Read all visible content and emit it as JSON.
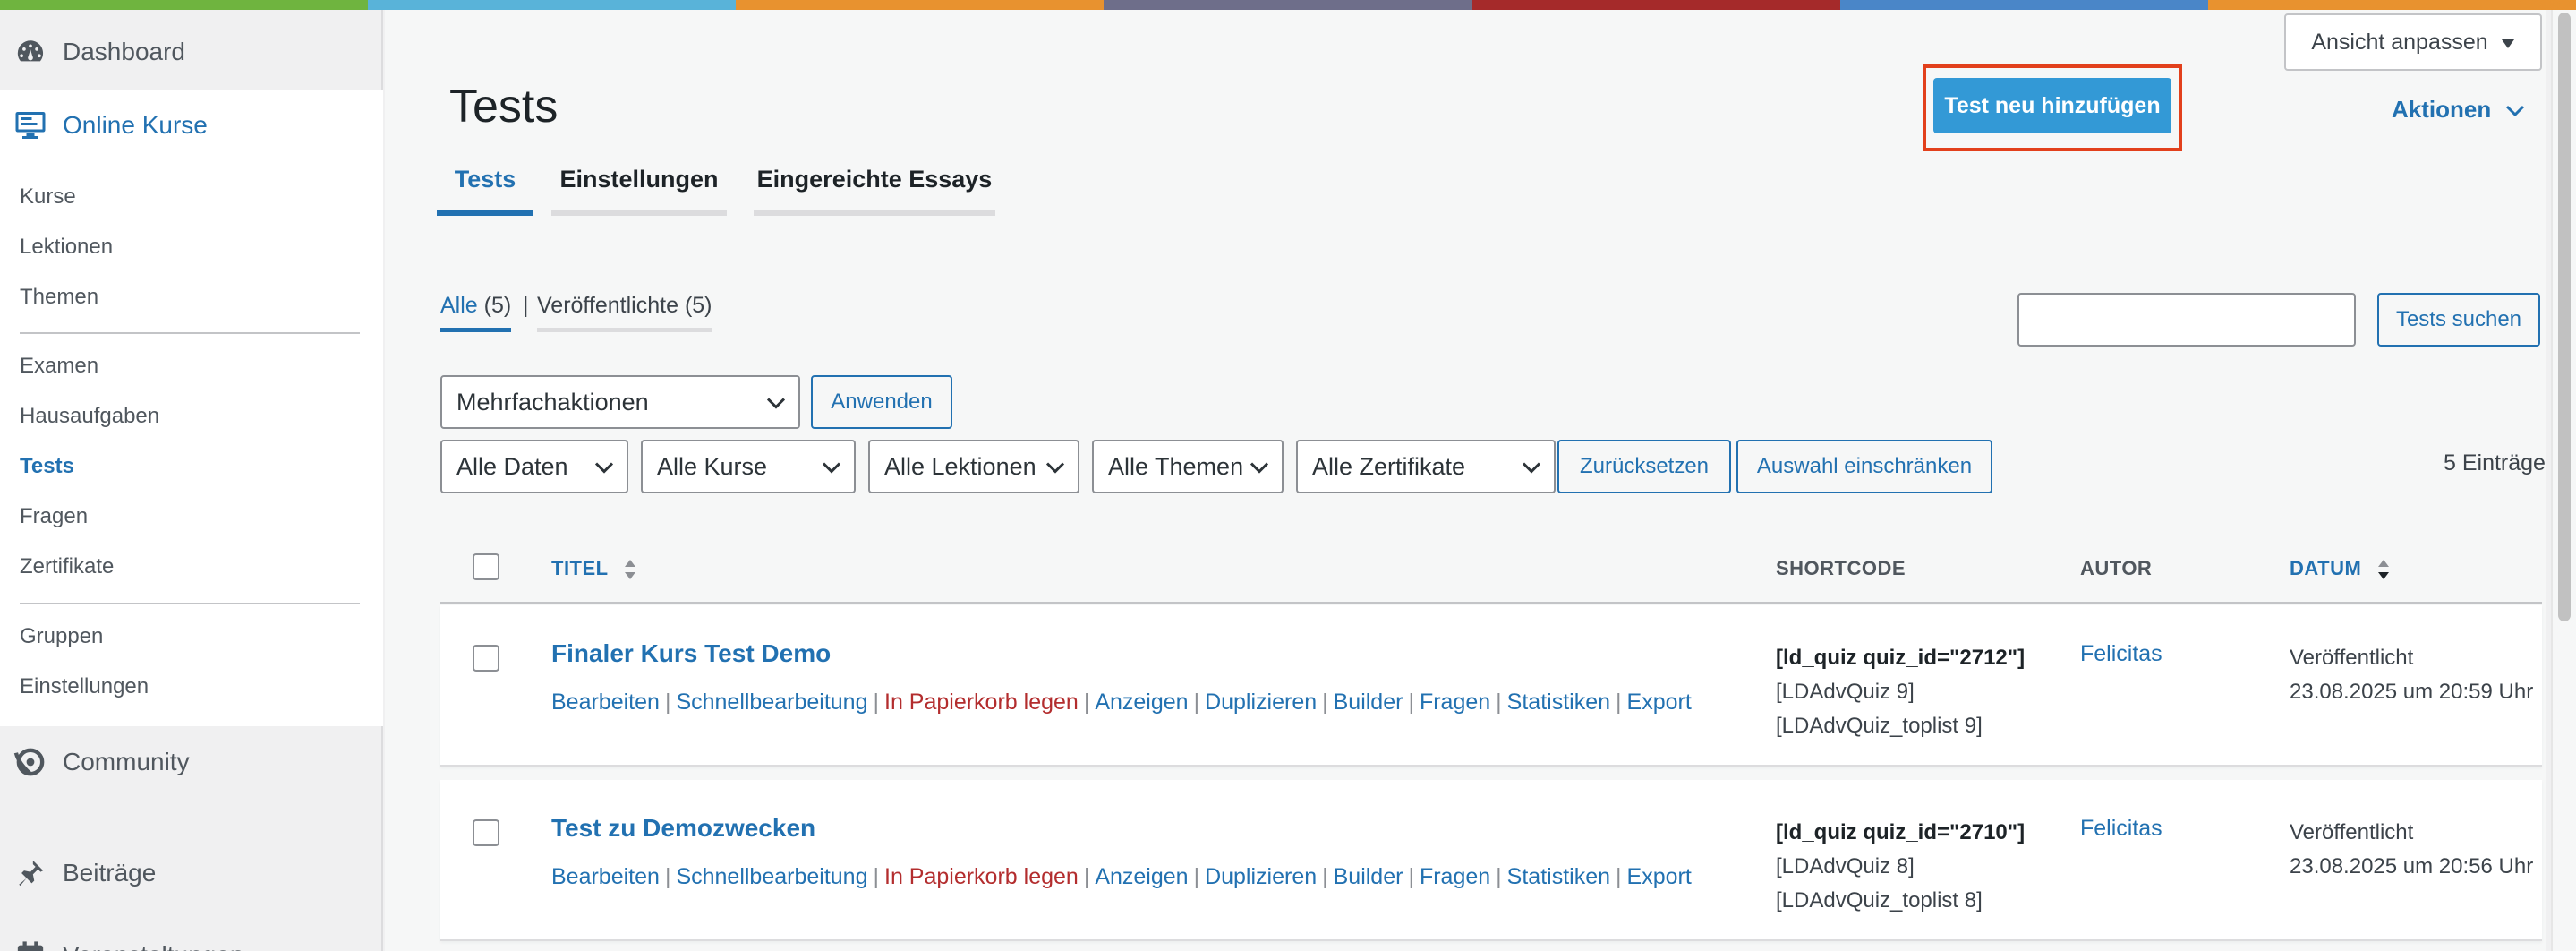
{
  "colors": {
    "rainbow": [
      "#6fb43f",
      "#59b3d9",
      "#e8922f",
      "#6e6e8a",
      "#a52a2a",
      "#4a86c8",
      "#e8922f"
    ],
    "accent": "#2271b1",
    "primary_button": "#3399d6",
    "highlight_outline": "#e2401c",
    "danger": "#b32d2e"
  },
  "sidebar": {
    "top_items": [
      {
        "label": "Dashboard",
        "icon": "dashboard-gauge-icon"
      },
      {
        "label": "Online Kurse",
        "icon": "desktop-monitor-icon"
      },
      {
        "label": "Community",
        "icon": "community-icon"
      },
      {
        "label": "Beiträge",
        "icon": "pushpin-icon"
      },
      {
        "label": "Veranstaltungen",
        "icon": "calendar-icon"
      }
    ],
    "submenu": [
      "Kurse",
      "Lektionen",
      "Themen",
      "Examen",
      "Hausaufgaben",
      "Tests",
      "Fragen",
      "Zertifikate",
      "Gruppen",
      "Einstellungen"
    ],
    "active_submenu": "Tests"
  },
  "header": {
    "title": "Tests",
    "add_button": "Test neu hinzufügen",
    "view_button": "Ansicht anpassen",
    "actions": "Aktionen"
  },
  "tabs": [
    "Tests",
    "Einstellungen",
    "Eingereichte Essays"
  ],
  "filters": {
    "all_label": "Alle",
    "all_count": "(5)",
    "published_label": "Veröffentlichte",
    "published_count": "(5)",
    "separator": "|",
    "search_button": "Tests suchen",
    "search_value": "",
    "bulk_select": "Mehrfachaktionen",
    "apply_button": "Anwenden",
    "dates_select": "Alle Daten",
    "courses_select": "Alle Kurse",
    "lessons_select": "Alle Lektionen",
    "topics_select": "Alle Themen",
    "certificates_select": "Alle Zertifikate",
    "reset_button": "Zurücksetzen",
    "narrow_button": "Auswahl einschränken",
    "count": "5 Einträge"
  },
  "table": {
    "headers": {
      "title": "TITEL",
      "shortcode": "SHORTCODE",
      "author": "AUTOR",
      "date": "DATUM"
    },
    "actions": [
      "Bearbeiten",
      "Schnellbearbeitung",
      "In Papierkorb legen",
      "Anzeigen",
      "Duplizieren",
      "Builder",
      "Fragen",
      "Statistiken",
      "Export"
    ],
    "rows": [
      {
        "title": "Finaler Kurs Test Demo",
        "shortcode_main": "[ld_quiz quiz_id=\"2712\"]",
        "shortcode_adv": "[LDAdvQuiz 9]",
        "shortcode_toplist": "[LDAdvQuiz_toplist 9]",
        "author": "Felicitas",
        "status": "Veröffentlicht",
        "date": "23.08.2025 um 20:59 Uhr"
      },
      {
        "title": "Test zu Demozwecken",
        "shortcode_main": "[ld_quiz quiz_id=\"2710\"]",
        "shortcode_adv": "[LDAdvQuiz 8]",
        "shortcode_toplist": "[LDAdvQuiz_toplist 8]",
        "author": "Felicitas",
        "status": "Veröffentlicht",
        "date": "23.08.2025 um 20:56 Uhr"
      }
    ]
  }
}
